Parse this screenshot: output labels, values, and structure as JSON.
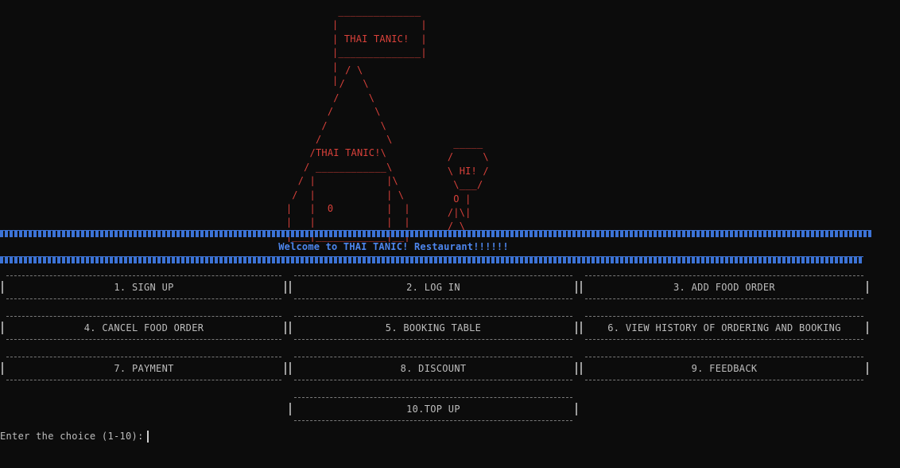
{
  "art": {
    "flag": " ______________\n|              |\n| THAI TANIC!  |\n|______________|\n|\n|",
    "house": "            / \\\n           /   \\\n          /     \\\n         /       \\\n        /         \\\n       /           \\\n      /THAI TANIC!\\\n     / ____________\\\n    / |            |\\\n   /  |            | \\\n  |   |  0         |  |\n  |   |            |  |\n  |___|____________|__|",
    "hi": "   _____\n  /     \\\n  \\ HI! /\n   \\___/\n   O |\n  /|\\|\n  / \\"
  },
  "welcome": "Welcome to THAI TANIC! Restaurant!!!!!!",
  "menu": [
    {
      "label": "1. SIGN UP"
    },
    {
      "label": "2. LOG IN"
    },
    {
      "label": "3. ADD FOOD ORDER"
    },
    {
      "label": "4. CANCEL FOOD ORDER"
    },
    {
      "label": "5. BOOKING TABLE"
    },
    {
      "label": "6. VIEW HISTORY OF ORDERING AND BOOKING"
    },
    {
      "label": "7. PAYMENT"
    },
    {
      "label": "8. DISCOUNT"
    },
    {
      "label": "9. FEEDBACK"
    },
    {
      "label": "10.TOP UP"
    }
  ],
  "prompt": "Enter the choice (1-10):",
  "colors": {
    "background": "#0c0c0c",
    "art": "#d9413a",
    "welcome": "#4d86ee",
    "rule": "#3c73d6",
    "text": "#bdbdbd"
  }
}
